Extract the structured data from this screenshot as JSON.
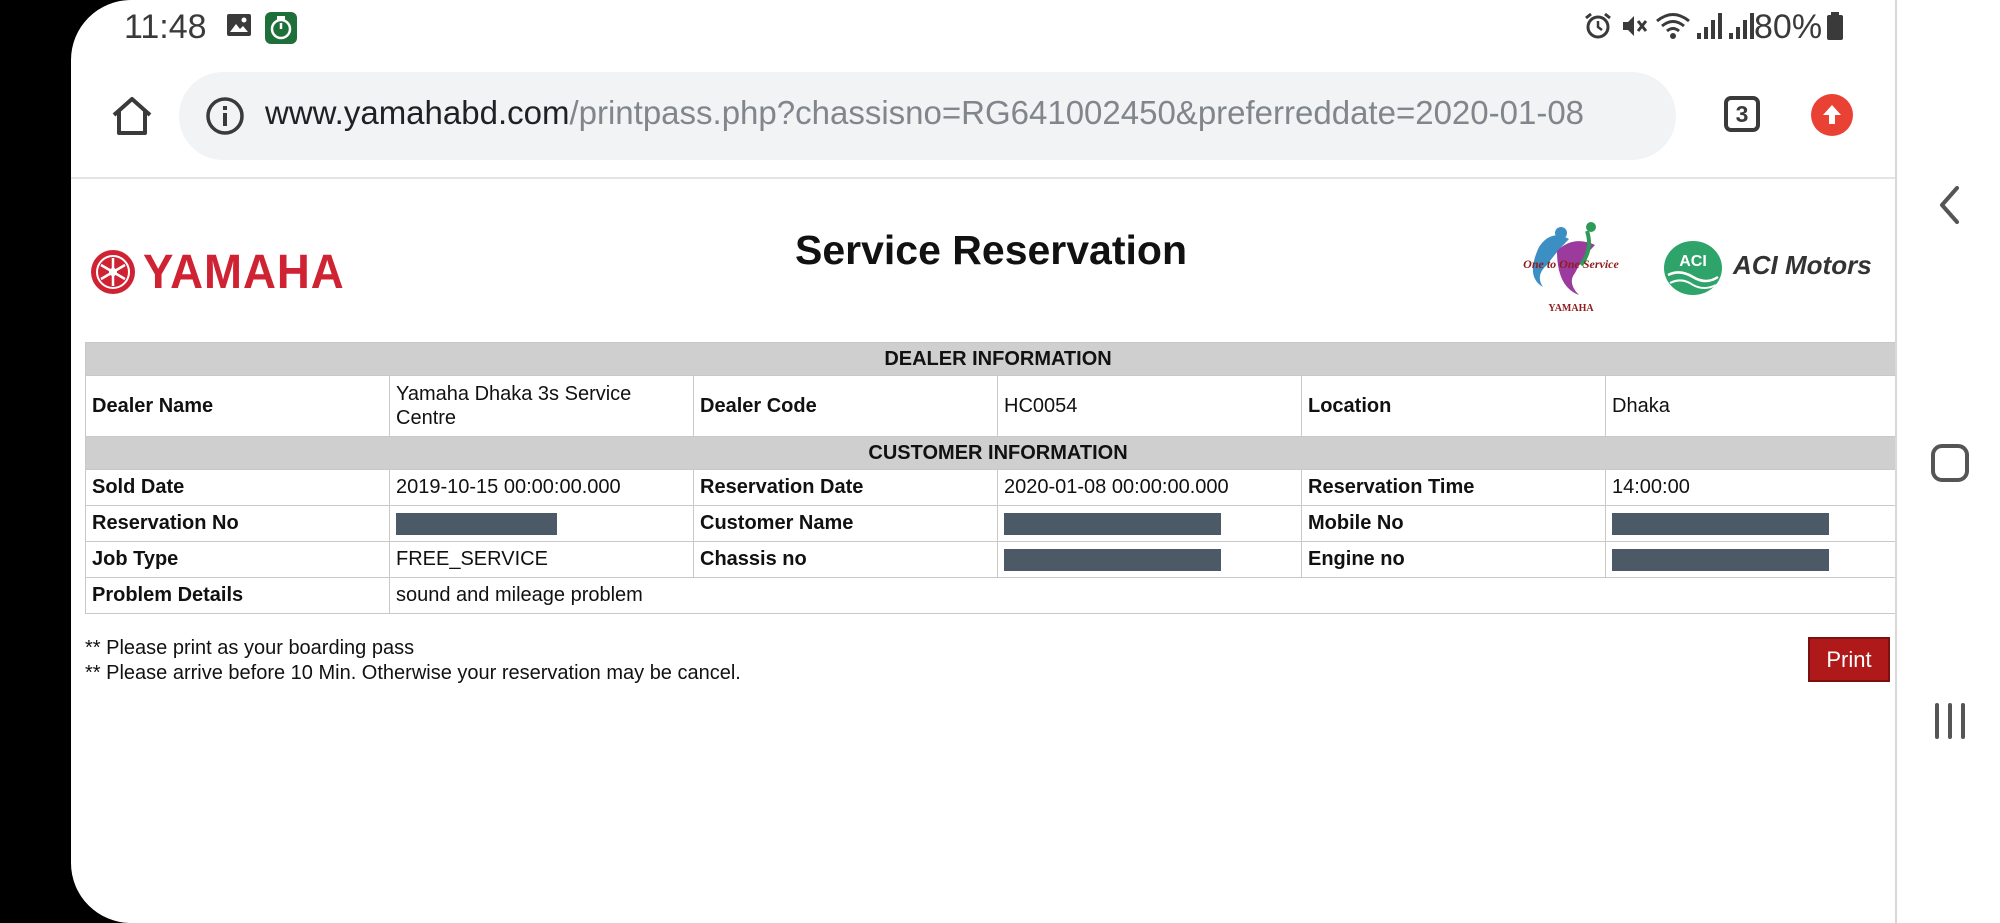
{
  "status_bar": {
    "time": "11:48",
    "battery": "80%",
    "icons": [
      "gallery-icon",
      "app-notification-icon",
      "alarm-icon",
      "mute-icon",
      "wifi-icon",
      "signal-icon",
      "signal-icon",
      "battery-icon"
    ]
  },
  "browser": {
    "url_domain": "www.yamahabd.com",
    "url_path": "/printpass.php?chassisno=RG641002450&preferreddate=2020-01-08",
    "tab_count": "3",
    "accent": "#e94235"
  },
  "page": {
    "title": "Service Reservation",
    "logo_text": "YAMAHA",
    "partner_logo_text": "One to One Service",
    "partner_logo_subtext": "YAMAHA",
    "aci_badge": "ACI",
    "aci_text": "ACI Motors",
    "brand_red": "#cf2233"
  },
  "dealer": {
    "section": "DEALER INFORMATION",
    "dealer_name_label": "Dealer Name",
    "dealer_name": "Yamaha Dhaka 3s Service Centre",
    "dealer_code_label": "Dealer Code",
    "dealer_code": "HC0054",
    "location_label": "Location",
    "location": "Dhaka"
  },
  "customer": {
    "section": "CUSTOMER INFORMATION",
    "sold_date_label": "Sold Date",
    "sold_date": "2019-10-15 00:00:00.000",
    "reservation_date_label": "Reservation Date",
    "reservation_date": "2020-01-08 00:00:00.000",
    "reservation_time_label": "Reservation Time",
    "reservation_time": "14:00:00",
    "reservation_no_label": "Reservation No",
    "customer_name_label": "Customer Name",
    "mobile_no_label": "Mobile No",
    "job_type_label": "Job Type",
    "job_type": "FREE_SERVICE",
    "chassis_no_label": "Chassis no",
    "engine_no_label": "Engine no",
    "problem_details_label": "Problem Details",
    "problem_details": "sound and mileage problem"
  },
  "notes": {
    "line1": "** Please print as your boarding pass",
    "line2": "** Please arrive before 10 Min. Otherwise your reservation may be cancel."
  },
  "actions": {
    "print_label": "Print",
    "print_color": "#b01919"
  },
  "nav": {
    "icons": [
      "back-icon",
      "home-icon",
      "recent-apps-icon"
    ]
  }
}
